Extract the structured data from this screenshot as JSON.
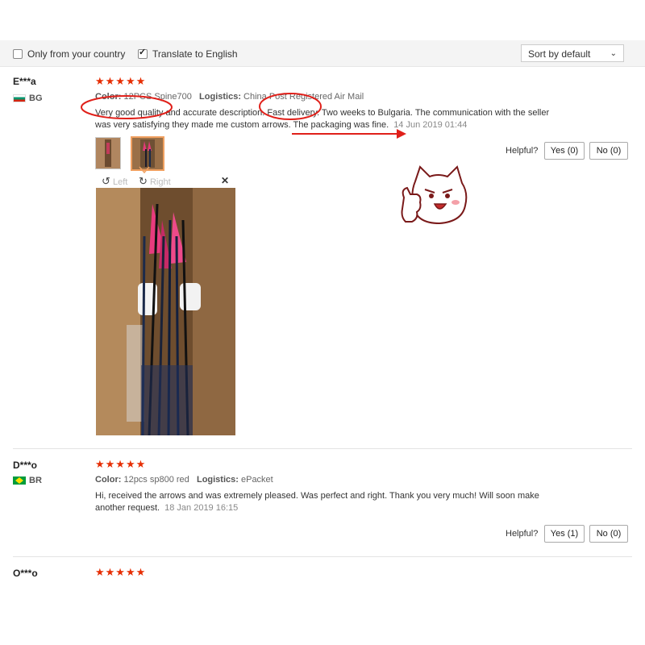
{
  "filters": {
    "only_country_label": "Only from your country",
    "only_country_checked": false,
    "translate_label": "Translate to English",
    "translate_checked": true,
    "sort_value": "Sort by default"
  },
  "reviews": [
    {
      "user": "E***a",
      "country": "BG",
      "rating": 5,
      "stars": "★★★★★",
      "color_label": "Color:",
      "color_value": "12PCS Spine700",
      "logistics_label": "Logistics:",
      "logistics_value": "China Post Registered Air Mail",
      "text_line1": "Very good quality and accurate description. Fast delivery. Two weeks to Bulgaria. The communication with the seller",
      "text_line2": "was very satisfying they made me custom arrows. The packaging was fine.",
      "date": "14 Jun 2019 01:44",
      "helpful_label": "Helpful?",
      "yes_label": "Yes (0)",
      "no_label": "No (0)",
      "photo_left_label": "Left",
      "photo_right_label": "Right"
    },
    {
      "user": "D***o",
      "country": "BR",
      "rating": 5,
      "stars": "★★★★★",
      "color_label": "Color:",
      "color_value": "12pcs sp800 red",
      "logistics_label": "Logistics:",
      "logistics_value": "ePacket",
      "text_line1": "Hi, received the arrows and was extremely pleased. Was perfect and right. Thank you very much! Will soon make",
      "text_line2": "another request.",
      "date": "18 Jan 2019 16:15",
      "helpful_label": "Helpful?",
      "yes_label": "Yes (1)",
      "no_label": "No (0)"
    },
    {
      "user": "O***o",
      "rating": 5,
      "stars": "★★★★★"
    }
  ],
  "colors": {
    "star": "#e62e04",
    "annotation": "#e0201a",
    "thumb_active_border": "#f0a060"
  },
  "icons": {
    "rotate_left": "rotate-left-icon",
    "rotate_right": "rotate-right-icon",
    "close": "close-icon",
    "sort_chevron": "chevron-down-icon"
  }
}
